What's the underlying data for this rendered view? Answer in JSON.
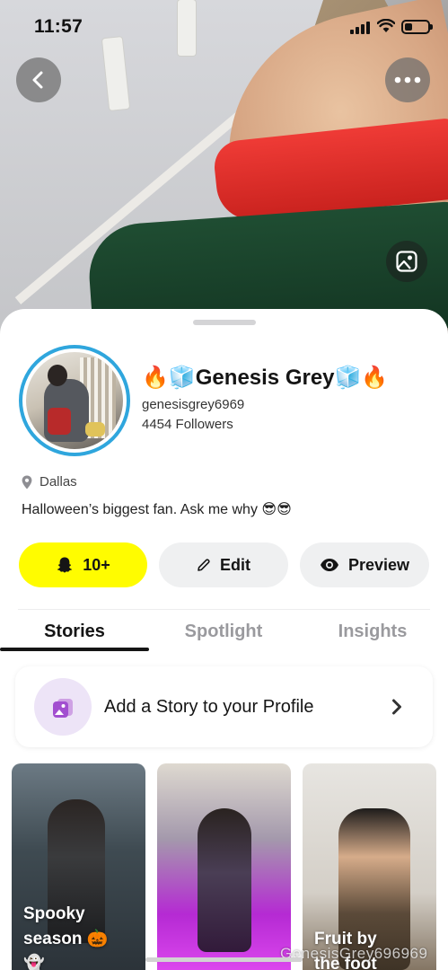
{
  "status_bar": {
    "time": "11:57",
    "battery_level": 0.35
  },
  "profile": {
    "display_name": "🔥🧊Genesis Grey🧊🔥",
    "username": "genesisgrey6969",
    "followers": "4454 Followers",
    "location": "Dallas",
    "bio": "Halloween’s biggest fan. Ask me why 😎😎"
  },
  "actions": {
    "subscribe_label": "10+",
    "edit_label": "Edit",
    "preview_label": "Preview"
  },
  "tabs": [
    {
      "label": "Stories",
      "active": true
    },
    {
      "label": "Spotlight",
      "active": false
    },
    {
      "label": "Insights",
      "active": false
    }
  ],
  "story_card": {
    "label": "Add a Story to your Profile"
  },
  "thumbnails": [
    {
      "caption": "Spooky\nseason 🎃\n👻"
    },
    {
      "caption": ""
    },
    {
      "caption": "Fruit by\nthe foot"
    }
  ],
  "watermark": "GenesisGrey696969",
  "colors": {
    "accent_yellow": "#fffc00",
    "avatar_ring": "#2fa6dd"
  }
}
